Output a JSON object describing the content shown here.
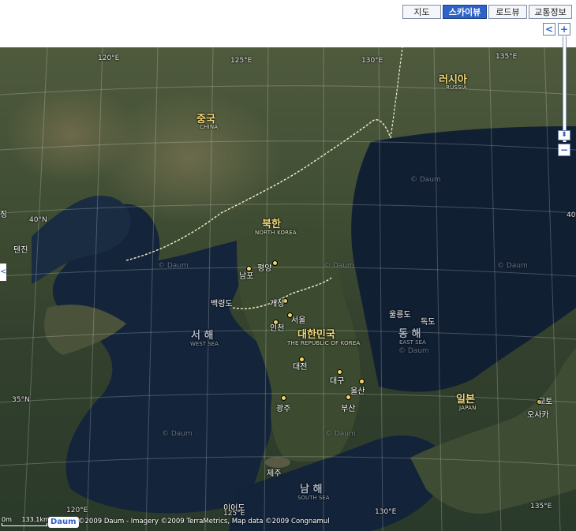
{
  "toolbar": {
    "map": "지도",
    "skyview": "스카이뷰",
    "roadview": "로드뷰",
    "traffic": "교통정보"
  },
  "zoom": {
    "prev": "<",
    "in": "+",
    "out": "−",
    "handle": "⬍"
  },
  "countries": {
    "china": {
      "ko": "중국",
      "en": "CHINA"
    },
    "russia": {
      "ko": "러시아",
      "en": "RUSSIA"
    },
    "north_korea": {
      "ko": "북한",
      "en": "NORTH KOREA"
    },
    "south_korea": {
      "ko": "대한민국",
      "en": "THE REPUBLIC OF KOREA"
    },
    "japan": {
      "ko": "일본",
      "en": "JAPAN"
    }
  },
  "seas": {
    "west": {
      "ko": "서 해",
      "en": "WEST SEA"
    },
    "east": {
      "ko": "동 해",
      "en": "EAST SEA"
    },
    "south": {
      "ko": "남 해",
      "en": "SOUTH SEA"
    }
  },
  "cities": {
    "pyongyang": "평양",
    "nampo": "남포",
    "baengnyeong": "백령도",
    "kaesong": "개성",
    "seoul": "서울",
    "incheon": "인천",
    "daejeon": "대전",
    "daegu": "대구",
    "ulsan": "울산",
    "busan": "부산",
    "gwangju": "광주",
    "jeju": "제주",
    "ieodo": "이어도",
    "ulleungdo": "울릉도",
    "dokdo": "독도",
    "kyoto": "교토",
    "osaka": "오사카",
    "tianjin": "텐진",
    "jing": "징"
  },
  "coords": {
    "lon120": "120°E",
    "lon125": "125°E",
    "lon130": "130°E",
    "lon135": "135°E",
    "lat40": "40°N",
    "lat35": "35°N",
    "lat40r": "40"
  },
  "watermark": "© Daum",
  "scale": {
    "zero": "0m",
    "dist": "133.1km"
  },
  "logo": "Daum",
  "copyright": "©2009 Daum - Imagery ©2009 TerraMetrics, Map data ©2009 Congnamul",
  "colors": {
    "active_tab": "#2f62c8",
    "country_label": "#f3da7a",
    "sea_label": "#a6b3c6"
  }
}
